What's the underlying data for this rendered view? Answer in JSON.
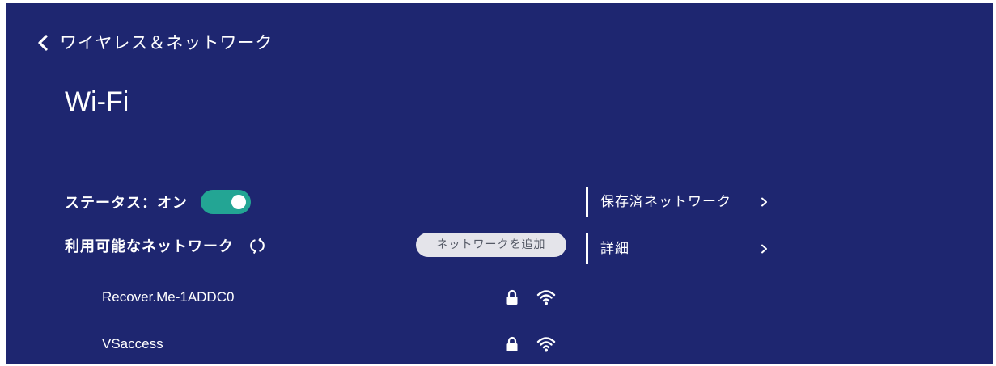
{
  "colors": {
    "background": "#1e2670",
    "accent": "#23a594",
    "button_bg": "#e4e4ea",
    "button_text": "#555a66"
  },
  "header": {
    "back_icon": "chevron-left-icon",
    "title": "ワイヤレス＆ネットワーク"
  },
  "page": {
    "title": "Wi-Fi"
  },
  "status": {
    "label": "ステータス：オン",
    "enabled": true
  },
  "networks": {
    "label": "利用可能なネットワーク",
    "refresh_icon": "refresh-icon",
    "add_button_label": "ネットワークを追加",
    "items": [
      {
        "name": "Recover.Me-1ADDC0",
        "secured": true,
        "signal": "full"
      },
      {
        "name": "VSaccess",
        "secured": true,
        "signal": "full"
      }
    ]
  },
  "side_menu": {
    "items": [
      {
        "label": "保存済ネットワーク"
      },
      {
        "label": "詳細"
      }
    ]
  }
}
